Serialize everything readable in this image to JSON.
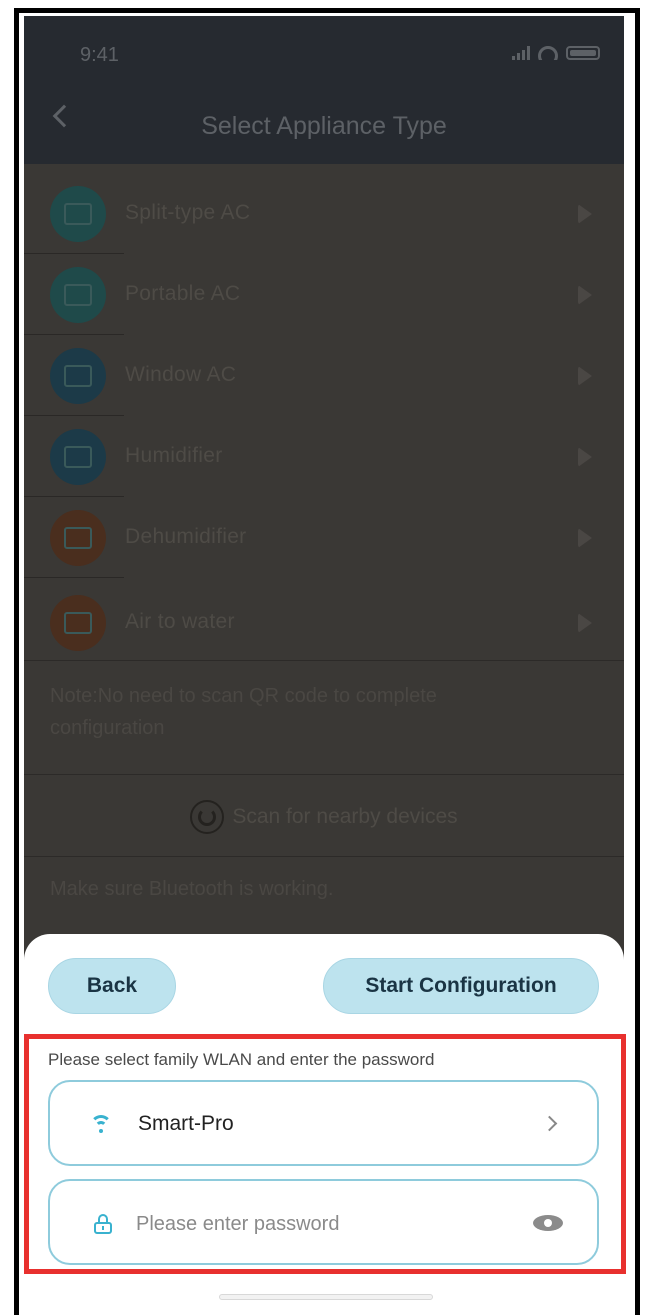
{
  "status_bar": {
    "time": "9:41"
  },
  "header": {
    "title": "Select Appliance Type"
  },
  "appliances": [
    {
      "label": "Split-type AC",
      "icon": "split-ac-icon",
      "color": "#1f4a4a"
    },
    {
      "label": "Portable AC",
      "icon": "portable-ac-icon",
      "color": "#1f4a4a"
    },
    {
      "label": "Window AC",
      "icon": "window-ac-icon",
      "color": "#1c3a48"
    },
    {
      "label": "Humidifier",
      "icon": "humidifier-icon",
      "color": "#1c3a48"
    },
    {
      "label": "Dehumidifier",
      "icon": "dehumidifier-icon",
      "color": "#4a2e1e"
    },
    {
      "label": "Air to water",
      "icon": "air-to-water-icon",
      "color": "#4a2e1e"
    }
  ],
  "note": "Note:No need to scan QR code to complete configuration",
  "scan": {
    "label": "Scan for nearby devices"
  },
  "bluetooth_note": "Make sure Bluetooth is working.",
  "sheet": {
    "back_label": "Back",
    "start_label": "Start Configuration",
    "wlan_prompt": "Please select family WLAN and enter the password",
    "ssid": "Smart-Pro",
    "password_value": "",
    "password_placeholder": "Please enter password"
  },
  "colors": {
    "accent": "#39b2cf",
    "button_bg": "#bde3ee",
    "highlight": "#e8302e"
  }
}
